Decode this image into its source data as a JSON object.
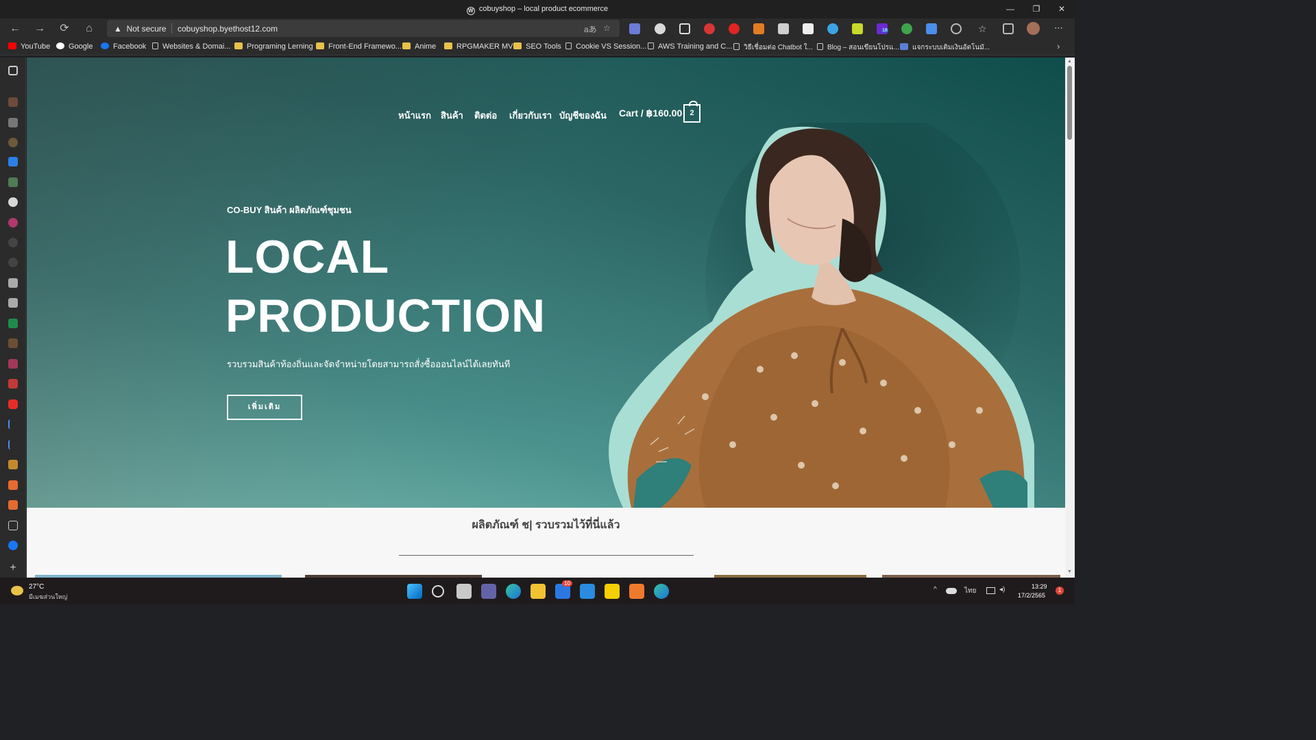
{
  "browser": {
    "window_title": "cobuyshop – local product ecommerce",
    "security_label": "Not secure",
    "url": "cobuyshop.byethost12.com",
    "extension_badge": "18"
  },
  "bookmarks": [
    {
      "label": "YouTube",
      "icon": "youtube-icon"
    },
    {
      "label": "Google",
      "icon": "google-icon"
    },
    {
      "label": "Facebook",
      "icon": "facebook-icon"
    },
    {
      "label": "Websites & Domai...",
      "icon": "page-icon"
    },
    {
      "label": "Programing Lerning",
      "icon": "folder-icon"
    },
    {
      "label": "Front-End Framewo...",
      "icon": "folder-icon"
    },
    {
      "label": "Anime",
      "icon": "folder-icon"
    },
    {
      "label": "RPGMAKER MV",
      "icon": "folder-icon"
    },
    {
      "label": "SEO Tools",
      "icon": "folder-icon"
    },
    {
      "label": "Cookie VS Session...",
      "icon": "page-icon"
    },
    {
      "label": "AWS Training and C...",
      "icon": "page-icon"
    },
    {
      "label": "วิธีเชื่อมต่อ Chatbot ใ...",
      "icon": "page-icon"
    },
    {
      "label": "Blog – สอนเขียนโปรแ...",
      "icon": "page-icon"
    },
    {
      "label": "แจกระบบเติมเงินอัตโนมั...",
      "icon": "app-icon"
    }
  ],
  "site": {
    "menu": [
      "หน้าแรก",
      "สินค้า",
      "ติดต่อ",
      "เกี่ยวกับเรา",
      "บัญชีของฉัน"
    ],
    "cart_label": "Cart / ฿160.00",
    "cart_count": "2",
    "hero": {
      "eyebrow": "CO-BUY สินค้า ผลิตภัณฑ์ชุมชน",
      "title_line1": "LOCAL",
      "title_line2": "PRODUCTION",
      "subtitle": "รวบรวมสินค้าท้องถิ่นและจัดจำหน่ายโดยสามารถสั่งซื้อออนไลน์ได้เลยทันที",
      "cta": "เพิ่มเติม"
    },
    "section_title": "ผลิตภัณฑ์ ช| รวบรวมไว้ที่นี่แล้ว"
  },
  "taskbar": {
    "temperature": "27°C",
    "weather_text": "มีเมฆส่วนใหญ่",
    "mail_badge": "10",
    "language": "ไทย",
    "time": "13:29",
    "date": "17/2/2565",
    "notification_count": "1"
  },
  "colors": {
    "hero_dark": "#0f4d4b",
    "hero_light": "#93d6c9",
    "taskbar": "#1f1b1d",
    "browser_chrome": "#2b2b2b"
  }
}
